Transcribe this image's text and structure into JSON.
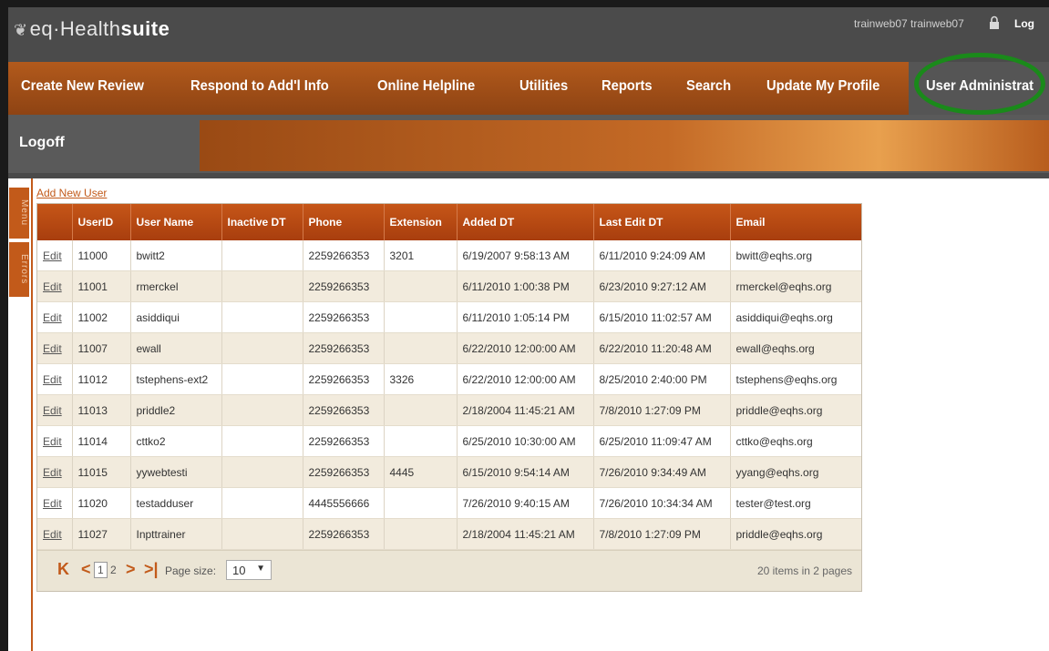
{
  "header": {
    "logo_prefix": "eq·Health",
    "logo_suffix": "suite",
    "user_info": "trainweb07 trainweb07",
    "logoff": "Log"
  },
  "nav": {
    "items": [
      {
        "label": "Create New Review"
      },
      {
        "label": "Respond to Add'l Info"
      },
      {
        "label": "Online Helpline"
      },
      {
        "label": "Utilities"
      },
      {
        "label": "Reports"
      },
      {
        "label": "Search"
      },
      {
        "label": "Update My Profile"
      },
      {
        "label": "User Administrat"
      }
    ],
    "sub_logoff": "Logoff",
    "highlight_color": "#1a8a1a"
  },
  "side_tabs": {
    "menu": "Menu",
    "errors": "Errors"
  },
  "grid": {
    "add_new_user": "Add New User",
    "columns": [
      "",
      "UserID",
      "User Name",
      "Inactive DT",
      "Phone",
      "Extension",
      "Added DT",
      "Last Edit DT",
      "Email"
    ],
    "edit_label": "Edit",
    "rows": [
      {
        "userid": "11000",
        "username": "bwitt2",
        "inactive": "",
        "phone": "2259266353",
        "extension": "3201",
        "added": "6/19/2007 9:58:13 AM",
        "lastedit": "6/11/2010 9:24:09 AM",
        "email": "bwitt@eqhs.org"
      },
      {
        "userid": "11001",
        "username": "rmerckel",
        "inactive": "",
        "phone": "2259266353",
        "extension": "",
        "added": "6/11/2010 1:00:38 PM",
        "lastedit": "6/23/2010 9:27:12 AM",
        "email": "rmerckel@eqhs.org"
      },
      {
        "userid": "11002",
        "username": "asiddiqui",
        "inactive": "",
        "phone": "2259266353",
        "extension": "",
        "added": "6/11/2010 1:05:14 PM",
        "lastedit": "6/15/2010 11:02:57 AM",
        "email": "asiddiqui@eqhs.org"
      },
      {
        "userid": "11007",
        "username": "ewall",
        "inactive": "",
        "phone": "2259266353",
        "extension": "",
        "added": "6/22/2010 12:00:00 AM",
        "lastedit": "6/22/2010 11:20:48 AM",
        "email": "ewall@eqhs.org"
      },
      {
        "userid": "11012",
        "username": "tstephens-ext2",
        "inactive": "",
        "phone": "2259266353",
        "extension": "3326",
        "added": "6/22/2010 12:00:00 AM",
        "lastedit": "8/25/2010 2:40:00 PM",
        "email": "tstephens@eqhs.org"
      },
      {
        "userid": "11013",
        "username": "priddle2",
        "inactive": "",
        "phone": "2259266353",
        "extension": "",
        "added": "2/18/2004 11:45:21 AM",
        "lastedit": "7/8/2010 1:27:09 PM",
        "email": "priddle@eqhs.org"
      },
      {
        "userid": "11014",
        "username": "cttko2",
        "inactive": "",
        "phone": "2259266353",
        "extension": "",
        "added": "6/25/2010 10:30:00 AM",
        "lastedit": "6/25/2010 11:09:47 AM",
        "email": "cttko@eqhs.org"
      },
      {
        "userid": "11015",
        "username": "yywebtesti",
        "inactive": "",
        "phone": "2259266353",
        "extension": "4445",
        "added": "6/15/2010 9:54:14 AM",
        "lastedit": "7/26/2010 9:34:49 AM",
        "email": "yyang@eqhs.org"
      },
      {
        "userid": "11020",
        "username": "testadduser",
        "inactive": "",
        "phone": "4445556666",
        "extension": "",
        "added": "7/26/2010 9:40:15 AM",
        "lastedit": "7/26/2010 10:34:34 AM",
        "email": "tester@test.org"
      },
      {
        "userid": "11027",
        "username": "Inpttrainer",
        "inactive": "",
        "phone": "2259266353",
        "extension": "",
        "added": "2/18/2004 11:45:21 AM",
        "lastedit": "7/8/2010 1:27:09 PM",
        "email": "priddle@eqhs.org"
      }
    ]
  },
  "pager": {
    "first": "K",
    "prev": "<",
    "pages": [
      "1",
      "2"
    ],
    "current_page": "1",
    "next": ">",
    "last": ">|",
    "page_size_label": "Page size:",
    "page_size_value": "10",
    "summary": "20 items in 2 pages"
  },
  "colors": {
    "accent": "#c25a1a",
    "header_bg": "#4b4b4b",
    "row_alt": "#f2ebdd"
  }
}
